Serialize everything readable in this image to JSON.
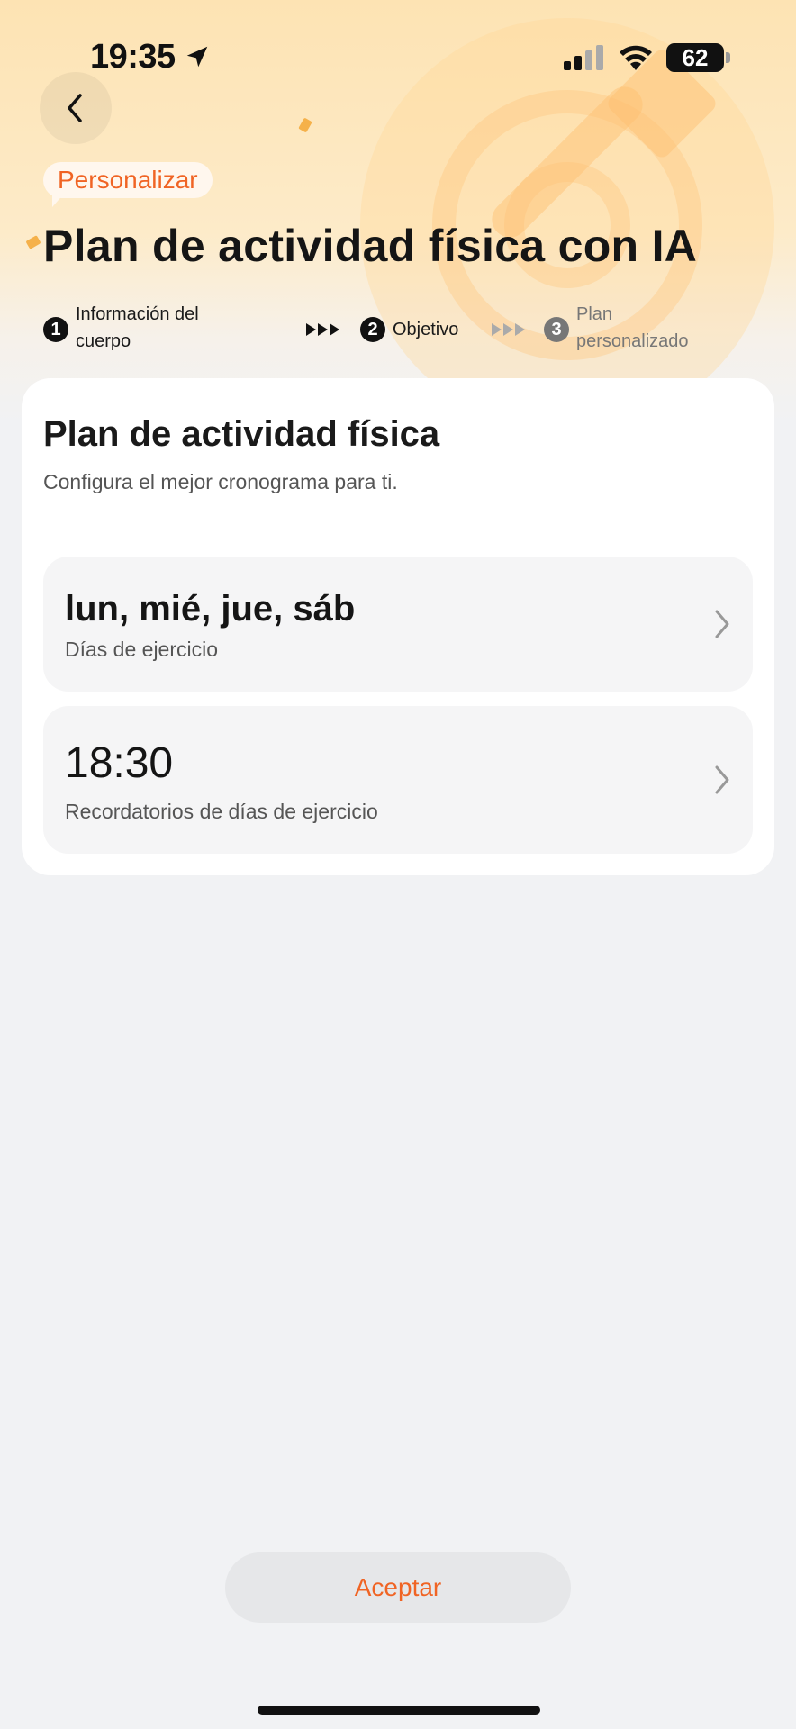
{
  "status_bar": {
    "time": "19:35",
    "battery": "62",
    "icons": [
      "location-arrow-icon",
      "signal-icon",
      "wifi-icon",
      "battery-icon"
    ]
  },
  "header": {
    "back_icon": "chevron-left-icon",
    "tag": "Personalizar",
    "title": "Plan de actividad física con IA"
  },
  "steps": [
    {
      "number": "1",
      "label": "Información del cuerpo",
      "active": true
    },
    {
      "number": "2",
      "label": "Objetivo",
      "active": true
    },
    {
      "number": "3",
      "label": "Plan personalizado",
      "active": false
    }
  ],
  "card": {
    "title": "Plan de actividad física",
    "subtitle": "Configura el mejor cronograma para ti.",
    "rows": [
      {
        "value": "lun, mié, jue, sáb",
        "label": "Días de ejercicio"
      },
      {
        "value": "18:30",
        "label": "Recordatorios de días de ejercicio"
      }
    ]
  },
  "footer": {
    "accept_label": "Aceptar"
  },
  "colors": {
    "accent": "#f06424",
    "hero_top": "#fde3b3",
    "background": "#f1f2f4"
  }
}
